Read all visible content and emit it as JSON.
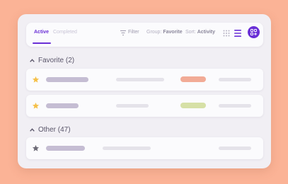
{
  "toolbar": {
    "tab_active": "Active",
    "tab_inactive": "Completed",
    "filter_label": "Filter",
    "group_prefix": "Group:",
    "group_value": "Favorite",
    "sort_prefix": "Sort:",
    "sort_value": "Activity",
    "icons": [
      "grid-view-icon",
      "list-view-icon",
      "add-icon"
    ]
  },
  "sections": [
    {
      "title": "Favorite (2)",
      "rows": [
        {
          "star_color": "#f5c04a",
          "status_color": "#f2ab96"
        },
        {
          "star_color": "#f5c04a",
          "status_color": "#d6e0a6"
        }
      ]
    },
    {
      "title": "Other (47)",
      "rows": [
        {
          "star_color": "#6c6a76"
        }
      ]
    }
  ],
  "colors": {
    "accent": "#6a2fd6",
    "background": "#fbb396",
    "card": "#f1eff4"
  }
}
